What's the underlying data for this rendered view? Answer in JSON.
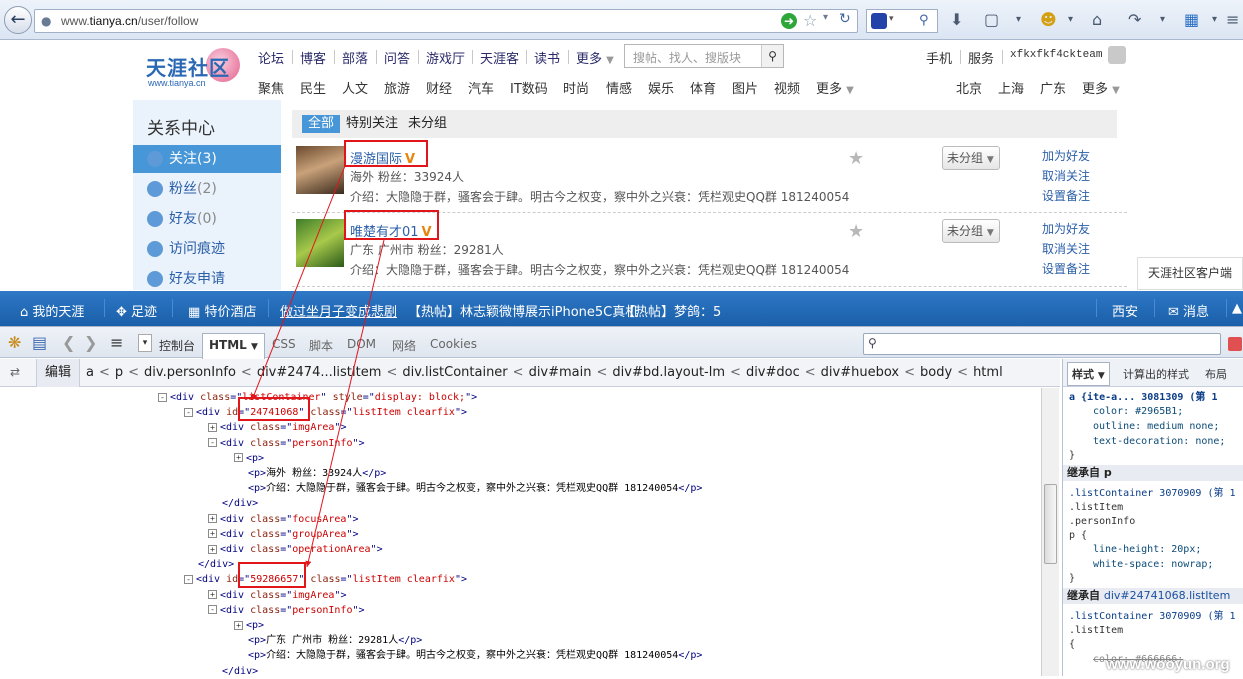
{
  "browser": {
    "url_prefix": "www.",
    "url_domain": "tianya.cn",
    "url_path": "/user/follow"
  },
  "logo": {
    "text": "天涯社区",
    "sub": "www.tianya.cn"
  },
  "nav_top": [
    "论坛",
    "博客",
    "部落",
    "问答",
    "游戏厅",
    "天涯客",
    "读书",
    "更多"
  ],
  "search_placeholder": "搜帖、找人、搜版块",
  "nav_right": {
    "phone": "手机",
    "service": "服务",
    "username": "xfkxfkf4ckteam"
  },
  "nav_bottom": [
    "聚焦",
    "民生",
    "人文",
    "旅游",
    "财经",
    "汽车",
    "IT数码",
    "时尚",
    "情感",
    "娱乐",
    "体育",
    "图片",
    "视频",
    "更多"
  ],
  "nav_cities": [
    "北京",
    "上海",
    "广东",
    "更多"
  ],
  "sidebar": {
    "title": "关系中心",
    "items": [
      {
        "label": "关注",
        "count": "(3)"
      },
      {
        "label": "粉丝",
        "count": "(2)"
      },
      {
        "label": "好友",
        "count": "(0)"
      },
      {
        "label": "访问痕迹",
        "count": ""
      },
      {
        "label": "好友申请",
        "count": ""
      }
    ]
  },
  "tabs": [
    "全部",
    "特别关注",
    "未分组"
  ],
  "persons": [
    {
      "name": "漫游国际",
      "v": "V",
      "info": "海外 粉丝：33924人",
      "intro": "介绍：大隐隐于群，骚客会于肆。明古今之权变，察中外之兴衰：凭栏观史QQ群 181240054",
      "group": "未分组"
    },
    {
      "name": "唯楚有才01",
      "v": "V",
      "info": "广东 广州市 粉丝：29281人",
      "intro": "介绍：大隐隐于群，骚客会于肆。明古今之权变，察中外之兴衰：凭栏观史QQ群 181240054",
      "group": "未分组"
    }
  ],
  "ops": [
    "加为好友",
    "取消关注",
    "设置备注"
  ],
  "client_box": "天涯社区客户端",
  "ty_bar": {
    "my_tianya": "我的天涯",
    "footprint": "足迹",
    "hotel": "特价酒店",
    "link1": "做过坐月子变成悲剧",
    "hot1": "【热帖】林志颖微博展示iPhone5C真机",
    "hot2": "【热帖】梦鸽：5",
    "city": "西安",
    "msg": "消息"
  },
  "firebug": {
    "tabs": [
      "控制台",
      "HTML",
      "CSS",
      "脚本",
      "DOM",
      "网络",
      "Cookies"
    ],
    "edit": "编辑",
    "crumbs": [
      "a",
      "p",
      "div.personInfo",
      "div#2474...listItem",
      "div.listContainer",
      "div#main",
      "div#bd.layout-lm",
      "div#doc",
      "div#huebox",
      "body",
      "html"
    ]
  },
  "html_tree": [
    {
      "indent": 0,
      "exp": "-",
      "parts": [
        [
          "tg",
          "<div "
        ],
        [
          "at",
          "class"
        ],
        [
          "tg",
          "=\""
        ],
        [
          "vl",
          "listContainer"
        ],
        [
          "tg",
          "\" "
        ],
        [
          "at",
          "style"
        ],
        [
          "tg",
          "=\""
        ],
        [
          "vl",
          "display: block;"
        ],
        [
          "tg",
          "\">"
        ]
      ]
    },
    {
      "indent": 1,
      "exp": "-",
      "parts": [
        [
          "tg",
          "<div "
        ],
        [
          "at",
          "id"
        ],
        [
          "tg",
          "=\""
        ],
        [
          "vl",
          "24741068"
        ],
        [
          "tg",
          "\" "
        ],
        [
          "at",
          "class"
        ],
        [
          "tg",
          "=\""
        ],
        [
          "vl",
          "listItem clearfix"
        ],
        [
          "tg",
          "\">"
        ]
      ]
    },
    {
      "indent": 2,
      "exp": "+",
      "parts": [
        [
          "tg",
          "<div "
        ],
        [
          "at",
          "class"
        ],
        [
          "tg",
          "=\""
        ],
        [
          "vl",
          "imgArea"
        ],
        [
          "tg",
          "\">"
        ]
      ]
    },
    {
      "indent": 2,
      "exp": "-",
      "parts": [
        [
          "tg",
          "<div "
        ],
        [
          "at",
          "class"
        ],
        [
          "tg",
          "=\""
        ],
        [
          "vl",
          "personInfo"
        ],
        [
          "tg",
          "\">"
        ]
      ]
    },
    {
      "indent": 3,
      "exp": "+",
      "parts": [
        [
          "tg",
          "<p>"
        ]
      ]
    },
    {
      "indent": 3,
      "exp": "",
      "parts": [
        [
          "tg",
          "<p>"
        ],
        [
          "tx",
          "海外 粉丝：33924人"
        ],
        [
          "tg",
          "</p>"
        ]
      ]
    },
    {
      "indent": 3,
      "exp": "",
      "parts": [
        [
          "tg",
          "<p>"
        ],
        [
          "tx",
          "介绍：大隐隐于群，骚客会于肆。明古今之权变，察中外之兴衰：凭栏观史QQ群 181240054"
        ],
        [
          "tg",
          "</p>"
        ]
      ]
    },
    {
      "indent": 2,
      "exp": "",
      "parts": [
        [
          "tg",
          "</div>"
        ]
      ]
    },
    {
      "indent": 2,
      "exp": "+",
      "parts": [
        [
          "tg",
          "<div "
        ],
        [
          "at",
          "class"
        ],
        [
          "tg",
          "=\""
        ],
        [
          "vl",
          "focusArea"
        ],
        [
          "tg",
          "\">"
        ]
      ]
    },
    {
      "indent": 2,
      "exp": "+",
      "parts": [
        [
          "tg",
          "<div "
        ],
        [
          "at",
          "class"
        ],
        [
          "tg",
          "=\""
        ],
        [
          "vl",
          "groupArea"
        ],
        [
          "tg",
          "\">"
        ]
      ]
    },
    {
      "indent": 2,
      "exp": "+",
      "parts": [
        [
          "tg",
          "<div "
        ],
        [
          "at",
          "class"
        ],
        [
          "tg",
          "=\""
        ],
        [
          "vl",
          "operationArea"
        ],
        [
          "tg",
          "\">"
        ]
      ]
    },
    {
      "indent": 1,
      "exp": "",
      "parts": [
        [
          "tg",
          "</div>"
        ]
      ]
    },
    {
      "indent": 1,
      "exp": "-",
      "parts": [
        [
          "tg",
          "<div "
        ],
        [
          "at",
          "id"
        ],
        [
          "tg",
          "=\""
        ],
        [
          "vl",
          "59286657"
        ],
        [
          "tg",
          "\" "
        ],
        [
          "at",
          "class"
        ],
        [
          "tg",
          "=\""
        ],
        [
          "vl",
          "listItem clearfix"
        ],
        [
          "tg",
          "\">"
        ]
      ]
    },
    {
      "indent": 2,
      "exp": "+",
      "parts": [
        [
          "tg",
          "<div "
        ],
        [
          "at",
          "class"
        ],
        [
          "tg",
          "=\""
        ],
        [
          "vl",
          "imgArea"
        ],
        [
          "tg",
          "\">"
        ]
      ]
    },
    {
      "indent": 2,
      "exp": "-",
      "parts": [
        [
          "tg",
          "<div "
        ],
        [
          "at",
          "class"
        ],
        [
          "tg",
          "=\""
        ],
        [
          "vl",
          "personInfo"
        ],
        [
          "tg",
          "\">"
        ]
      ]
    },
    {
      "indent": 3,
      "exp": "+",
      "parts": [
        [
          "tg",
          "<p>"
        ]
      ]
    },
    {
      "indent": 3,
      "exp": "",
      "parts": [
        [
          "tg",
          "<p>"
        ],
        [
          "tx",
          "广东 广州市 粉丝：29281人"
        ],
        [
          "tg",
          "</p>"
        ]
      ]
    },
    {
      "indent": 3,
      "exp": "",
      "parts": [
        [
          "tg",
          "<p>"
        ],
        [
          "tx",
          "介绍：大隐隐于群，骚客会于肆。明古今之权变，察中外之兴衰：凭栏观史QQ群 181240054"
        ],
        [
          "tg",
          "</p>"
        ]
      ]
    },
    {
      "indent": 2,
      "exp": "",
      "parts": [
        [
          "tg",
          "</div>"
        ]
      ]
    }
  ],
  "style_panel": {
    "tabs": [
      "样式",
      "计算出的样式",
      "布局"
    ],
    "rule1_selector": "a {ite-a... 3081309 (第 1",
    "rule1_props": [
      "color: #2965B1;",
      "outline: medium none;",
      "text-decoration: none;"
    ],
    "inherit1": "继承自 p",
    "rule2_selectors": [
      ".listContainer 3070909 (第 1",
      ".listItem",
      ".personInfo",
      "p {"
    ],
    "rule2_props": [
      "line-height: 20px;",
      "white-space: nowrap;"
    ],
    "inherit2_prefix": "继承自",
    "inherit2_target": "div#24741068.listItem",
    "rule3_selectors": [
      ".listContainer 3070909 (第 1",
      ".listItem",
      "{"
    ],
    "rule3_props": [
      "color: #666666;"
    ]
  },
  "watermark": "www.wooyun.org",
  "colors": {
    "accent": "#4796d8",
    "annotation_red": "#e1161b",
    "link": "#2965B1"
  }
}
